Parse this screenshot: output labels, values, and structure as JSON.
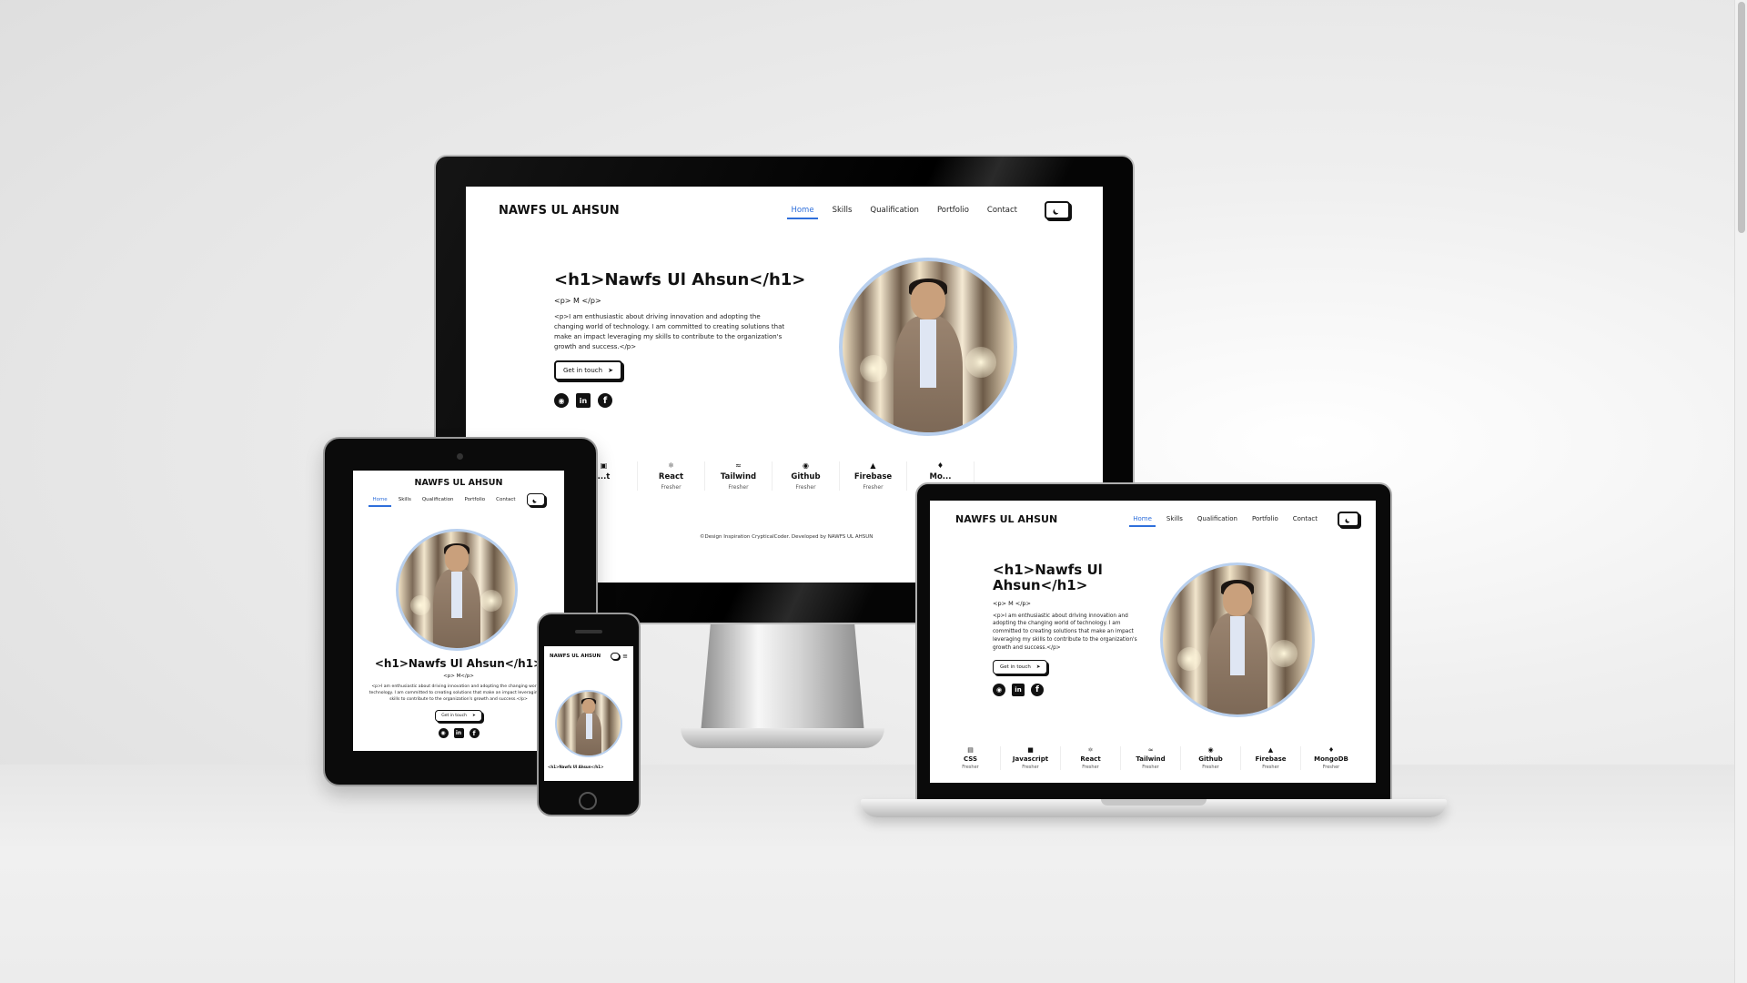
{
  "site": {
    "brand": "NAWFS UL AHSUN",
    "nav": [
      "Home",
      "Skills",
      "Qualification",
      "Portfolio",
      "Contact"
    ],
    "active_nav": "Home",
    "hero_title": "<h1>Nawfs Ul Ahsun</h1>",
    "hero_title_line1": "<h1>Nawfs Ul",
    "hero_title_line2": "Ahsun</h1>",
    "hero_subtitle": "<p> M </p>",
    "hero_subtitle_tablet": "<p> M</p>",
    "hero_description": "<p>I am enthusiastic about driving innovation and adopting the changing world of technology. I am committed to creating solutions that make an impact leveraging my skills to contribute to the organization's growth and success.</p>",
    "cta_label": "Get in touch",
    "cta_icon": "send-icon",
    "social_icons": [
      "github-icon",
      "linkedin-icon",
      "facebook-icon"
    ],
    "theme_icon": "moon-icon",
    "menu_icon": "hamburger-menu-icon",
    "footer": "©Design Inspiration CrypticalCoder. Developed by NAWFS UL AHSUN",
    "accent_color": "#2f6fdb",
    "avatar_ring_color": "#b9d0ee"
  },
  "desktop_skills": [
    {
      "name": "...t",
      "level": ""
    },
    {
      "name": "React",
      "level": "Fresher"
    },
    {
      "name": "Tailwind",
      "level": "Fresher"
    },
    {
      "name": "Github",
      "level": "Fresher"
    },
    {
      "name": "Firebase",
      "level": "Fresher"
    },
    {
      "name": "Mo...",
      "level": ""
    }
  ],
  "laptop_skills": [
    {
      "name": "CSS",
      "level": "Fresher"
    },
    {
      "name": "Javascript",
      "level": "Fresher"
    },
    {
      "name": "React",
      "level": "Fresher"
    },
    {
      "name": "Tailwind",
      "level": "Fresher"
    },
    {
      "name": "Github",
      "level": "Fresher"
    },
    {
      "name": "Firebase",
      "level": "Fresher"
    },
    {
      "name": "MongoDB",
      "level": "Fresher"
    }
  ]
}
